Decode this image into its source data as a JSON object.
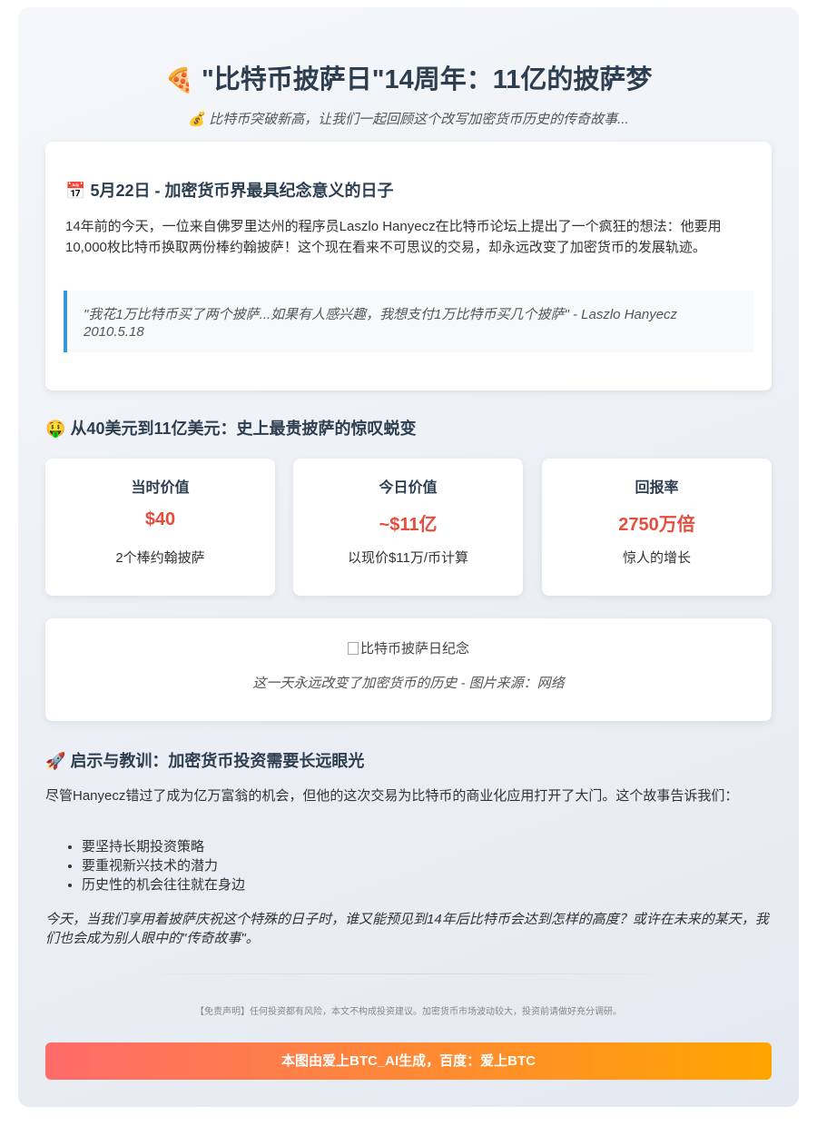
{
  "header": {
    "title_icon": "pizza-icon",
    "title": "\"比特币披萨日\"14周年：11亿的披萨梦",
    "subtitle_icon": "money-bag-icon",
    "subtitle": "比特币突破新高，让我们一起回顾这个改写加密货币历史的传奇故事..."
  },
  "intro": {
    "heading_icon": "calendar-icon",
    "heading": "5月22日 - 加密货币界最具纪念意义的日子",
    "body": "14年前的今天，一位来自佛罗里达州的程序员Laszlo Hanyecz在比特币论坛上提出了一个疯狂的想法：他要用10,000枚比特币换取两份棒约翰披萨！这个现在看来不可思议的交易，却永远改变了加密货币的发展轨迹。",
    "quote": "\"我花1万比特币买了两个披萨...如果有人感兴趣，我想支付1万比特币买几个披萨\" - Laszlo Hanyecz 2010.5.18"
  },
  "value_section": {
    "heading_icon": "money-face-icon",
    "heading": "从40美元到11亿美元：史上最贵披萨的惊叹蜕变",
    "stats": [
      {
        "label": "当时价值",
        "value": "$40",
        "desc": "2个棒约翰披萨"
      },
      {
        "label": "今日价值",
        "value": "~$11亿",
        "desc": "以现价$11万/币计算"
      },
      {
        "label": "回报率",
        "value": "2750万倍",
        "desc": "惊人的增长"
      }
    ]
  },
  "image": {
    "alt": "比特币披萨日纪念",
    "caption": "这一天永远改变了加密货币的历史 - 图片来源：网络"
  },
  "lessons": {
    "heading_icon": "rocket-icon",
    "heading": "启示与教训：加密货币投资需要长远眼光",
    "body": "尽管Hanyecz错过了成为亿万富翁的机会，但他的这次交易为比特币的商业化应用打开了大门。这个故事告诉我们：",
    "items": [
      "要坚持长期投资策略",
      "要重视新兴技术的潜力",
      "历史性的机会往往就在身边"
    ],
    "closing": "今天，当我们享用着披萨庆祝这个特殊的日子时，谁又能预见到14年后比特币会达到怎样的高度？或许在未来的某天，我们也会成为别人眼中的\"传奇故事\"。"
  },
  "footer": {
    "disclaimer": "【免责声明】任何投资都有风险，本文不构成投资建议。加密货币市场波动较大，投资前请做好充分调研。",
    "banner": "本图由爱上BTC_AI生成，百度：爱上BTC"
  },
  "colors": {
    "accent_red": "#e74c3c",
    "quote_border": "#3498db",
    "banner_start": "#ff6b6b",
    "banner_end": "#ffa500"
  }
}
